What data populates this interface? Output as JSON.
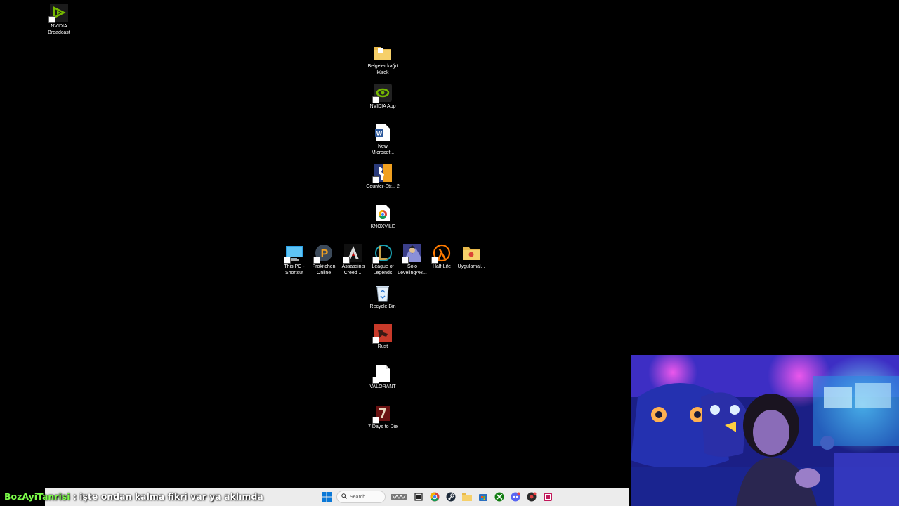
{
  "desktop_icons": [
    {
      "id": "nvidia-broadcast",
      "label": "NVIDIA Broadcast",
      "glyph": "nvidia-broadcast-icon"
    },
    {
      "id": "belgeler",
      "label": "Belgeler kağıt kürek",
      "glyph": "folder-icon"
    },
    {
      "id": "nvidia-app",
      "label": "NVIDIA App",
      "glyph": "nvidia-app-icon"
    },
    {
      "id": "new-word",
      "label": "New Microsof...",
      "glyph": "word-document-icon"
    },
    {
      "id": "cs2",
      "label": "Counter-Str... 2",
      "glyph": "counter-strike-icon"
    },
    {
      "id": "knoxvile",
      "label": "KNOXVILE",
      "glyph": "chrome-file-icon"
    },
    {
      "id": "this-pc",
      "label": "This PC - Shortcut",
      "glyph": "monitor-icon"
    },
    {
      "id": "prokitchen",
      "label": "Prokitchen Online",
      "glyph": "prokitchen-icon"
    },
    {
      "id": "assassins",
      "label": "Assassin's Creed ...",
      "glyph": "assassins-creed-icon"
    },
    {
      "id": "lol",
      "label": "League of Legends",
      "glyph": "league-of-legends-icon"
    },
    {
      "id": "solo",
      "label": "Solo LevelingAR...",
      "glyph": "solo-leveling-icon"
    },
    {
      "id": "half-life",
      "label": "Half-Life",
      "glyph": "half-life-icon"
    },
    {
      "id": "uygulama",
      "label": "Uygulamal...",
      "glyph": "folder-icon"
    },
    {
      "id": "recycle",
      "label": "Recycle Bin",
      "glyph": "recycle-bin-icon"
    },
    {
      "id": "rust",
      "label": "Rust",
      "glyph": "rust-icon"
    },
    {
      "id": "valorant",
      "label": "VALORANT",
      "glyph": "blank-file-icon"
    },
    {
      "id": "7days",
      "label": "7 Days to Die",
      "glyph": "seven-days-icon"
    }
  ],
  "taskbar": {
    "search_placeholder": "Search",
    "apps": [
      "windows-start-icon",
      "search-icon",
      "widgets-icon",
      "task-view-icon",
      "chrome-icon",
      "steam-icon",
      "file-explorer-icon",
      "store-icon",
      "xbox-icon",
      "discord-icon",
      "app-icon",
      "media-icon"
    ]
  },
  "chat": {
    "username": "BozAyiTanrisi",
    "separator": " : ",
    "message": "işte ondan kalma fikri var ya aklımda"
  },
  "colors": {
    "chat_username": "#7dff4a",
    "taskbar_bg": "#ececec",
    "desktop_bg": "#000000"
  }
}
